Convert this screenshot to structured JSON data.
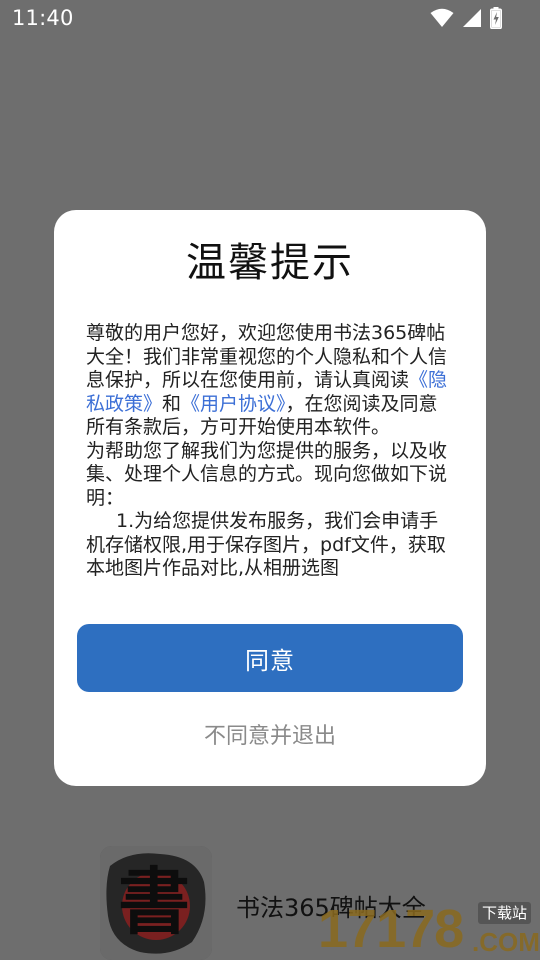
{
  "status_bar": {
    "time": "11:40",
    "icons": [
      "wifi-icon",
      "signal-icon",
      "battery-charging-icon"
    ]
  },
  "dialog": {
    "title": "温馨提示",
    "body": {
      "p1_a": "尊敬的用户您好，欢迎您使用书法365碑帖大全！我们非常重视您的个人隐私和个人信息保护，所以在您使用前，请认真阅读",
      "privacy_link": "《隐私政策》",
      "and": "和",
      "user_agreement_link": "《用户协议》",
      "p1_b": "，在您阅读及同意所有条款后，方可开始使用本软件。",
      "p2": "为帮助您了解我们为您提供的服务，以及收集、处理个人信息的方式。现向您做如下说明：",
      "p3": "1.为给您提供发布服务，我们会申请手机存储权限,用于保存图片，pdf文件，获取本地图片作品对比,从相册选图"
    },
    "agree_label": "同意",
    "disagree_label": "不同意并退出"
  },
  "background_app": {
    "name": "书法365碑帖大全",
    "logo_char": "書"
  },
  "watermark": {
    "number": "17178",
    "suffix": ".COM",
    "tag": "下载站"
  },
  "colors": {
    "overlay": "#6e6e6e",
    "accent": "#2e6fc0",
    "link": "#3c6fd6"
  }
}
